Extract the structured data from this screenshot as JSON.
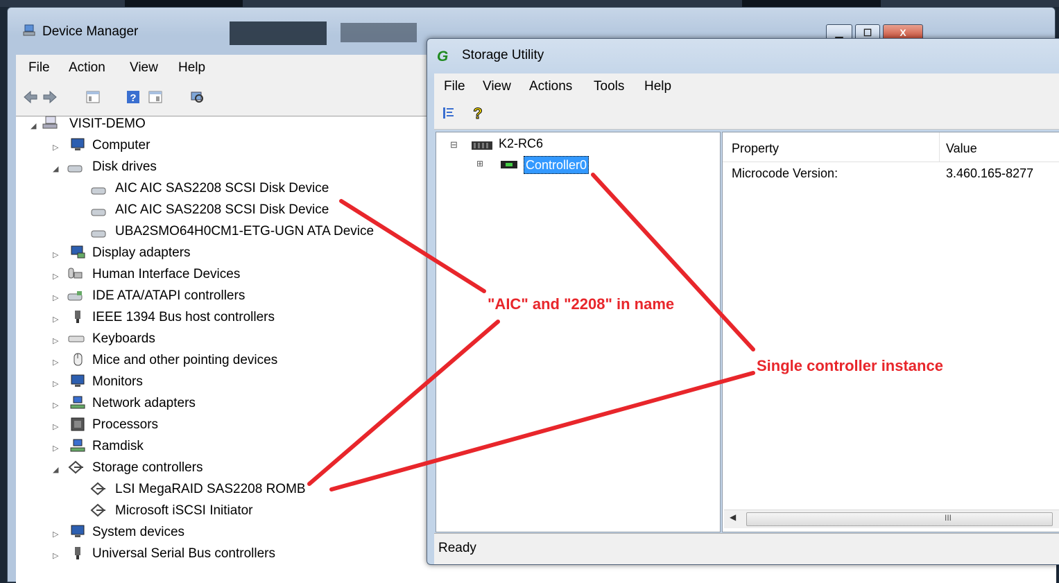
{
  "device_manager": {
    "title": "Device Manager",
    "menu": [
      "File",
      "Action",
      "View",
      "Help"
    ],
    "tree": {
      "root": "VISIT-DEMO",
      "computer": "Computer",
      "disk_drives": "Disk drives",
      "disk1": "AIC AIC SAS2208 SCSI Disk Device",
      "disk2": "AIC AIC SAS2208 SCSI Disk Device",
      "disk3": "UBA2SMO64H0CM1-ETG-UGN ATA Device",
      "display": "Display adapters",
      "hid": "Human Interface Devices",
      "ide": "IDE ATA/ATAPI controllers",
      "ieee": "IEEE 1394 Bus host controllers",
      "keyboards": "Keyboards",
      "mice": "Mice and other pointing devices",
      "monitors": "Monitors",
      "network": "Network adapters",
      "processors": "Processors",
      "ramdisk": "Ramdisk",
      "storage": "Storage controllers",
      "lsi": "LSI MegaRAID SAS2208 ROMB",
      "iscsi": "Microsoft iSCSI Initiator",
      "system": "System devices",
      "usb": "Universal Serial Bus controllers"
    },
    "window_buttons": {
      "minimize": "▁",
      "maximize": "☐",
      "close": "X"
    }
  },
  "storage_utility": {
    "title": "Storage Utility",
    "logo": "G",
    "menu": [
      "File",
      "View",
      "Actions",
      "Tools",
      "Help"
    ],
    "tree": {
      "root": "K2-RC6",
      "controller": "Controller0"
    },
    "grid": {
      "headers": [
        "Property",
        "Value"
      ],
      "rows": [
        [
          "Microcode Version:",
          "3.460.165-8277"
        ]
      ]
    },
    "scroll_grip": "III",
    "status": "Ready"
  },
  "annotations": {
    "aic": "\"AIC\" and \"2208\" in name",
    "single": "Single controller instance"
  },
  "colors": {
    "annotation": "#e8262b",
    "selection": "#3399ff",
    "accent_green": "#1f8a1f"
  }
}
